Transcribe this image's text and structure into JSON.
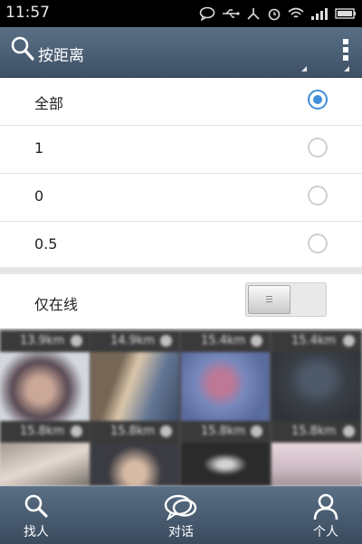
{
  "status": {
    "time": "11:57"
  },
  "header": {
    "title": "按距离"
  },
  "filter": {
    "options": [
      {
        "label": "全部",
        "selected": true
      },
      {
        "label": "1",
        "selected": false
      },
      {
        "label": "0",
        "selected": false
      },
      {
        "label": "0.5",
        "selected": false
      }
    ],
    "online_only_label": "仅在线",
    "online_only_enabled": false
  },
  "nearby": {
    "distances": [
      "13.9km",
      "14.9km",
      "15.4km",
      "15.4km",
      "15.8km",
      "15.8km",
      "15.8km",
      "15.8km"
    ]
  },
  "bottom_nav": {
    "find_people": "找人",
    "chat": "对话",
    "profile": "个人"
  },
  "colors": {
    "accent": "#3f8ed8",
    "bar": "#4a5d73"
  }
}
